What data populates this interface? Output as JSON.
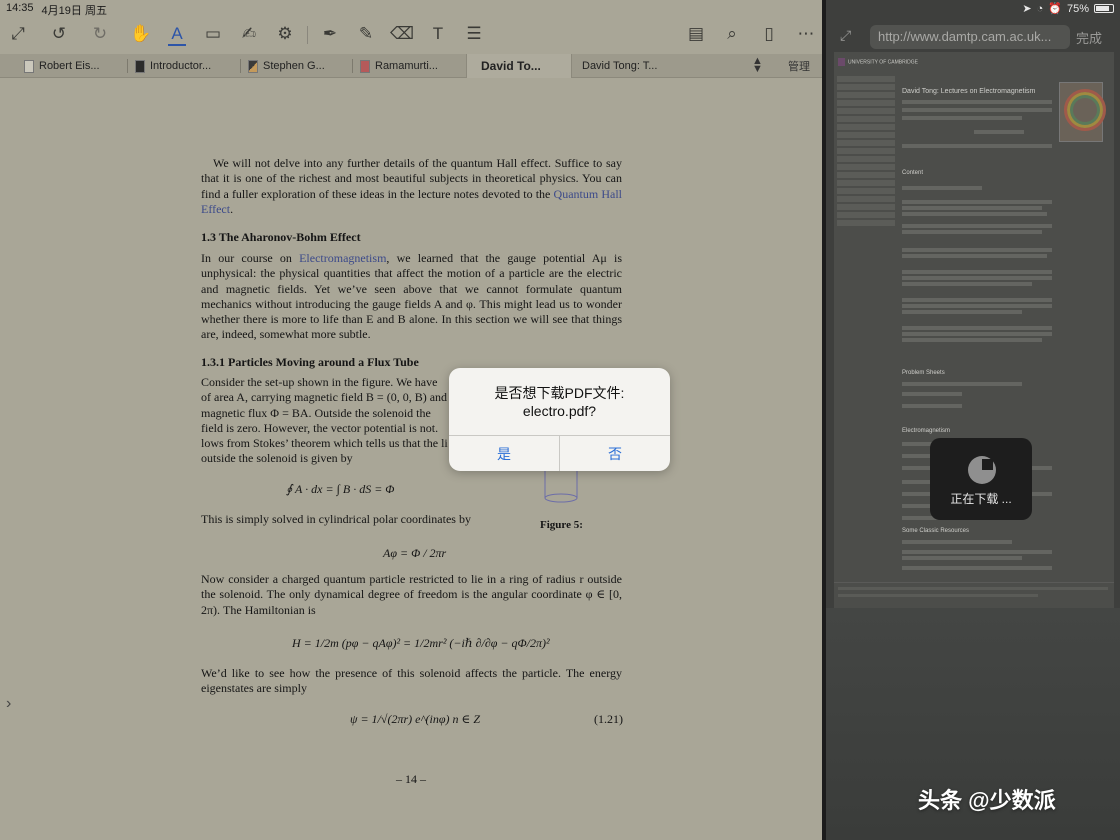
{
  "status_bar": {
    "time": "14:35",
    "date": "4月19日 周五",
    "battery": "75%"
  },
  "toolbar": {
    "icons": [
      "expand-icon",
      "undo-icon",
      "redo-icon",
      "hand-icon",
      "text-highlight-icon",
      "rectangle-select-icon",
      "signature-icon",
      "stamp-icon",
      "pen-icon",
      "highlighter-icon",
      "eraser-icon",
      "text-box-icon",
      "note-icon",
      "document-icon",
      "search-icon",
      "bookmark-icon",
      "more-icon"
    ]
  },
  "tabs": [
    {
      "label": "Robert Eis..."
    },
    {
      "label": "Introductor..."
    },
    {
      "label": "Stephen G..."
    },
    {
      "label": "Ramamurti..."
    },
    {
      "label": "David To..."
    },
    {
      "label": "David Tong: T..."
    }
  ],
  "tabs_manage": "管理",
  "document": {
    "p1": "We will not delve into any further details of the quantum Hall effect. Suffice to say that it is one of the richest and most beautiful subjects in theoretical physics. You can find a fuller exploration of these ideas in the lecture notes devoted to the ",
    "p1_link": "Quantum Hall Effect",
    "p1_end": ".",
    "h1": "1.3 The Aharonov-Bohm Effect",
    "p2_start": "In our course on ",
    "p2_link": "Electromagnetism",
    "p2_rest": ", we learned that the gauge potential Aμ is unphysical: the physical quantities that affect the motion of a particle are the electric and magnetic fields. Yet we’ve seen above that we cannot formulate quantum mechanics without introducing the gauge fields A and φ. This might lead us to wonder whether there is more to life than E and B alone. In this section we will see that things are, indeed, somewhat more subtle.",
    "h2": "1.3.1 Particles Moving around a Flux Tube",
    "p3_lines": [
      "Consider the set-up shown in the figure. We have",
      "of area A, carrying magnetic field B = (0, 0, B) and",
      "magnetic flux Φ = BA. Outside the solenoid the",
      "field is zero. However, the vector potential is not.",
      "lows from Stokes’ theorem which tells us that the li",
      "outside the solenoid is given by"
    ],
    "eq1": "∮ A · dx = ∫ B · dS = Φ",
    "figure_caption": "Figure 5:",
    "p4": "This is simply solved in cylindrical polar coordinates by",
    "eq2": "Aφ = Φ / 2πr",
    "p5": "Now consider a charged quantum particle restricted to lie in a ring of radius r outside the solenoid. The only dynamical degree of freedom is the angular coordinate φ ∈ [0, 2π). The Hamiltonian is",
    "eq3": "H = 1/2m (pφ − qAφ)² = 1/2mr² (−iℏ ∂/∂φ − qΦ/2π)²",
    "p6": "We’d like to see how the presence of this solenoid affects the particle. The energy eigenstates are simply",
    "eq4": "ψ = 1/√(2πr) e^(inφ)     n ∈ Z",
    "eq4_number": "(1.21)",
    "page_number": "– 14 –"
  },
  "browser": {
    "url": "http://www.damtp.cam.ac.uk...",
    "done": "完成",
    "university": "UNIVERSITY OF CAMBRIDGE",
    "page_title": "David Tong: Lectures on Electromagnetism",
    "headings": [
      "Content",
      "Problem Sheets",
      "Electromagnetism",
      "Some Classic Resources"
    ],
    "download_status": "正在下载 ..."
  },
  "dialog": {
    "title_line1": "是否想下载PDF文件:",
    "title_line2": "electro.pdf?",
    "yes": "是",
    "no": "否"
  },
  "watermark": "头条 @少数派"
}
